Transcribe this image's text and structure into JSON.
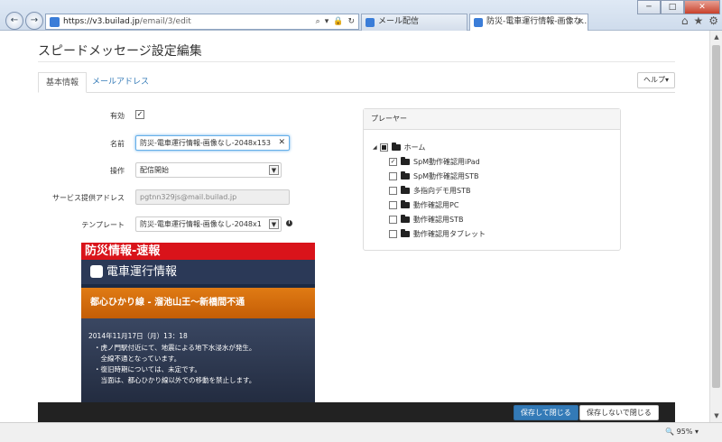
{
  "browser": {
    "url_host": "https://v3.builad.jp",
    "url_path": "/email/3/edit",
    "tabs": [
      {
        "label": "メール配信"
      },
      {
        "label": "防災-電車運行情報-画像な..."
      }
    ],
    "window_controls": {
      "minimize": "─",
      "maximize": "□",
      "close": "✕"
    },
    "zoom": "95%"
  },
  "page": {
    "title": "スピードメッセージ設定編集",
    "tabs": [
      {
        "label": "基本情報",
        "active": true
      },
      {
        "label": "メールアドレス",
        "active": false
      }
    ],
    "help_label": "ヘルプ▾"
  },
  "form": {
    "enabled_label": "有効",
    "enabled_checked": true,
    "name_label": "名前",
    "name_value": "防災-電車運行情報-画像なし-2048x153",
    "operation_label": "操作",
    "operation_value": "配信開始",
    "service_address_label": "サービス提供アドレス",
    "service_address_value": "pgtnn329js@mail.builad.jp",
    "template_label": "テンプレート",
    "template_value": "防災-電車運行情報-画像なし-2048x1"
  },
  "preview": {
    "header": "防災情報-速報",
    "subheader": "電車運行情報",
    "alert": "都心ひかり線 - 溜池山王〜新橋間不通",
    "date": "2014年11月17日（月）13：18",
    "lines": [
      "・虎ノ門駅付近にて、地震による地下水浸水が発生。",
      "　全線不通となっています。",
      "・復旧時期については、未定です。",
      "　当面は、都心ひかり線以外での移動を禁止します。"
    ]
  },
  "player": {
    "title": "プレーヤー",
    "root": {
      "label": "ホーム"
    },
    "items": [
      {
        "label": "SpM動作確認用iPad",
        "checked": true
      },
      {
        "label": "SpM動作確認用STB",
        "checked": false
      },
      {
        "label": "多指向デモ用STB",
        "checked": false
      },
      {
        "label": "動作確認用PC",
        "checked": false
      },
      {
        "label": "動作確認用STB",
        "checked": false
      },
      {
        "label": "動作確認用タブレット",
        "checked": false
      }
    ]
  },
  "actions": {
    "save_close": "保存して閉じる",
    "close_no_save": "保存しないで閉じる"
  }
}
